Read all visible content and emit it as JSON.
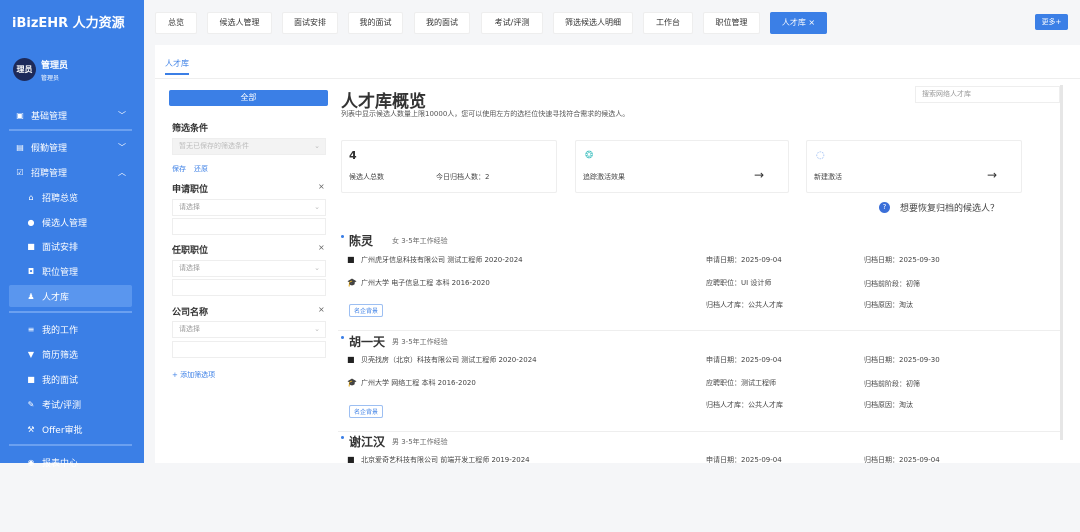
{
  "app": {
    "title": "iBizEHR 人力资源"
  },
  "user": {
    "avatar": "理员",
    "name": "管理员",
    "role": "管理员"
  },
  "sidebar": {
    "items": [
      {
        "label": "基础管理",
        "icon": "user-card-icon"
      },
      {
        "label": "假勤管理",
        "icon": "calendar-icon"
      },
      {
        "label": "招聘管理",
        "icon": "recruit-icon"
      },
      {
        "label": "招聘总览",
        "icon": "home-icon"
      },
      {
        "label": "候选人管理",
        "icon": "person-icon"
      },
      {
        "label": "面试安排",
        "icon": "mail-icon"
      },
      {
        "label": "职位管理",
        "icon": "briefcase-icon"
      },
      {
        "label": "人才库",
        "icon": "users-icon"
      },
      {
        "label": "我的工作",
        "icon": "list-icon"
      },
      {
        "label": "简历筛选",
        "icon": "filter-icon"
      },
      {
        "label": "我的面试",
        "icon": "card-icon"
      },
      {
        "label": "考试/评测",
        "icon": "pencil-icon"
      },
      {
        "label": "Offer审批",
        "icon": "gavel-icon"
      },
      {
        "label": "报表中心",
        "icon": "chart-icon"
      }
    ]
  },
  "tabs": [
    "总览",
    "候选人管理",
    "面试安排",
    "我的面试",
    "我的面试",
    "考试/评测",
    "筛选候选人明细",
    "工作台",
    "职位管理",
    "人才库"
  ],
  "tab_close": "×",
  "more_label": "更多+",
  "subtab": "人才库",
  "filter": {
    "all_label": "全部",
    "conditions_label": "筛选条件",
    "saved_placeholder": "暂无已保存的筛选条件",
    "save": "保存",
    "restore": "还原",
    "fields": [
      {
        "label": "申请职位",
        "placeholder": "请选择"
      },
      {
        "label": "任职职位",
        "placeholder": "请选择"
      },
      {
        "label": "公司名称",
        "placeholder": "请选择"
      }
    ],
    "remove": "×",
    "add": "+ 添加筛选项"
  },
  "main": {
    "title": "人才库概览",
    "desc": "列表中显示候选人数量上限10000人，您可以使用左方的选栏位快速寻找符合需求的候选人。",
    "search_placeholder": "搜索网络人才库",
    "stats": {
      "total": "4",
      "total_label": "候选人总数",
      "today_label": "今日归档人数：2"
    },
    "track_label": "追踪激活效果",
    "new_label": "新建激活",
    "arrow": "→",
    "restore_q": "想要恢复归档的候选人？"
  },
  "candidates": [
    {
      "name": "陈灵",
      "meta": "女  3-5年工作经验",
      "work": "广州虎牙信息科技有限公司  测试工程师  2020-2024",
      "edu": "广州大学  电子信息工程  本科  2016-2020",
      "badge": "名企背景",
      "apply_date": "申请日期：2025-09-04",
      "position": "应聘职位：UI 设计师",
      "pool": "归档人才库：公共人才库",
      "archive_date": "归档日期：2025-09-30",
      "stage": "归档前阶段：初筛",
      "reason": "归档原因：淘汰"
    },
    {
      "name": "胡一天",
      "meta": "男  3-5年工作经验",
      "work": "贝壳找房（北京）科技有限公司  测试工程师  2020-2024",
      "edu": "广州大学  网络工程  本科  2016-2020",
      "badge": "名企背景",
      "apply_date": "申请日期：2025-09-04",
      "position": "应聘职位：测试工程师",
      "pool": "归档人才库：公共人才库",
      "archive_date": "归档日期：2025-09-30",
      "stage": "归档前阶段：初筛",
      "reason": "归档原因：淘汰"
    },
    {
      "name": "谢江汉",
      "meta": "男  3-5年工作经验",
      "work": "北京爱奇艺科技有限公司  前端开发工程师  2019-2024",
      "apply_date": "申请日期：2025-09-04",
      "archive_date": "归档日期：2025-09-04"
    }
  ]
}
